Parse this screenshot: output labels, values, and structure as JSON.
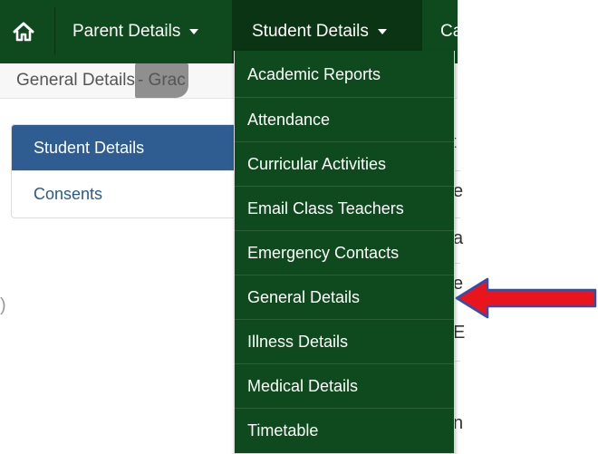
{
  "navbar": {
    "home_icon": "home-icon",
    "items": [
      {
        "label": "Parent Details"
      },
      {
        "label": "Student Details"
      },
      {
        "label": "Ca"
      }
    ]
  },
  "breadcrumb": {
    "prefix": "General Details",
    "smudged": " - Grac"
  },
  "side_menu": {
    "items": [
      {
        "label": "Student Details",
        "active": true
      },
      {
        "label": "Consents"
      }
    ]
  },
  "background_fragments": [
    "t",
    "e",
    "a",
    "e",
    "E",
    "n",
    ")"
  ],
  "dropdown": {
    "items": [
      {
        "label": "Academic Reports"
      },
      {
        "label": "Attendance"
      },
      {
        "label": "Curricular Activities"
      },
      {
        "label": "Email Class Teachers"
      },
      {
        "label": "Emergency Contacts"
      },
      {
        "label": "General Details"
      },
      {
        "label": "Illness Details"
      },
      {
        "label": "Medical Details"
      },
      {
        "label": "Timetable"
      }
    ]
  },
  "annotation": {
    "arrow_color": "#e8161c",
    "arrow_border": "#2b4fb3",
    "points_to": "General Details"
  },
  "colors": {
    "navbar": "#0f4a1f",
    "dropdown": "#0e4a1d",
    "active_side_item": "#2f5d91"
  }
}
